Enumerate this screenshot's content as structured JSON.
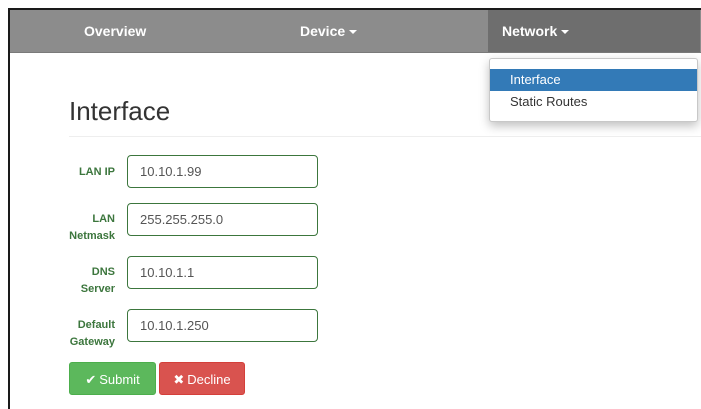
{
  "navbar": {
    "items": [
      {
        "label": "Overview"
      },
      {
        "label": "Device"
      },
      {
        "label": "Network"
      }
    ]
  },
  "dropdown": {
    "items": [
      {
        "label": "Interface",
        "active": true
      },
      {
        "label": "Static Routes",
        "active": false
      }
    ]
  },
  "page": {
    "title": "Interface"
  },
  "form": {
    "lan_ip": {
      "label_line1": "LAN IP",
      "label_line2": "",
      "value": "10.10.1.99"
    },
    "lan_netmask": {
      "label_line1": "LAN",
      "label_line2": "Netmask",
      "value": "255.255.255.0"
    },
    "dns_server": {
      "label_line1": "DNS",
      "label_line2": "Server",
      "value": "10.10.1.1"
    },
    "default_gateway": {
      "label_line1": "Default",
      "label_line2": "Gateway",
      "value": "10.10.1.250"
    }
  },
  "buttons": {
    "submit": {
      "label": "Submit",
      "icon": "checkmark-icon"
    },
    "decline": {
      "label": "Decline",
      "icon": "x-icon"
    }
  },
  "colors": {
    "navbar": "#8c8c8c",
    "nav_active": "#6e6e6e",
    "dropdown_active": "#337ab7",
    "success_label": "#3c763d",
    "submit": "#5cb85c",
    "decline": "#d9534f"
  }
}
